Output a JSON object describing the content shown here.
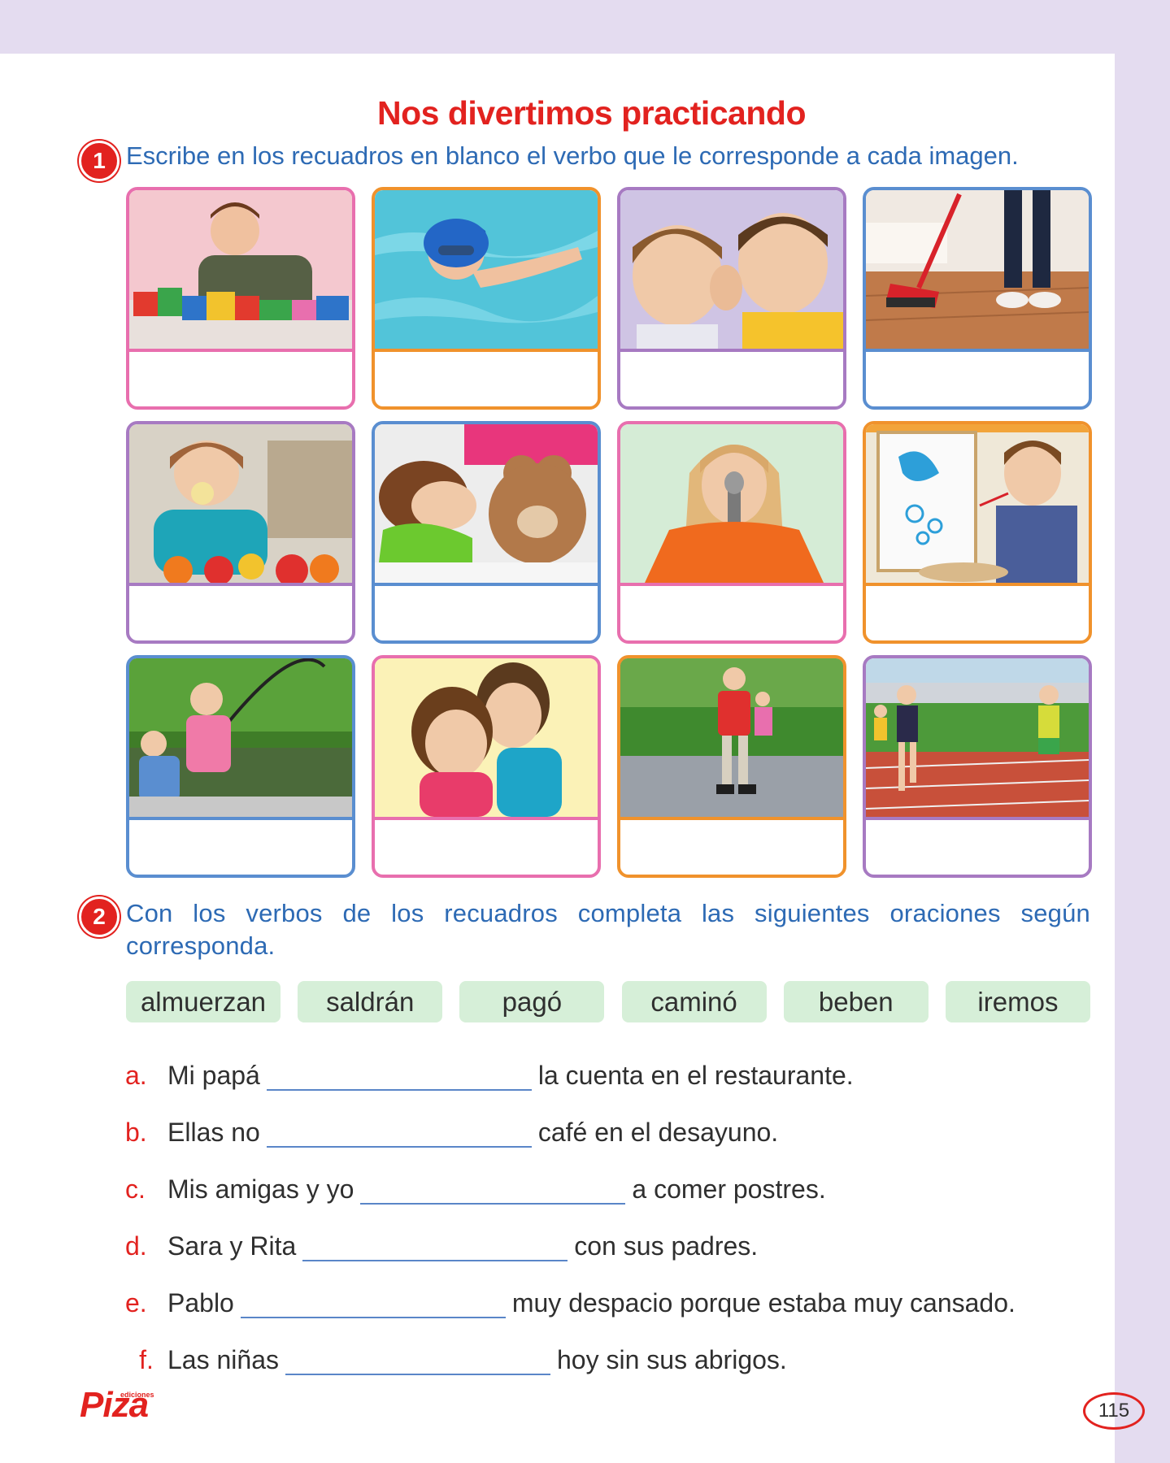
{
  "title": "Nos divertimos practicando",
  "exercise1": {
    "number": "1",
    "instruction": "Escribe en los recuadros en blanco el verbo que le corresponde a cada imagen.",
    "images": [
      {
        "icon": "boy-building-blocks-photo",
        "frame": "#e86fae"
      },
      {
        "icon": "child-swimming-photo",
        "frame": "#f0922c"
      },
      {
        "icon": "boys-whispering-photo",
        "frame": "#a77ac2"
      },
      {
        "icon": "sweeping-floor-photo",
        "frame": "#5a8ed0"
      },
      {
        "icon": "girl-eating-apple-photo",
        "frame": "#a77ac2"
      },
      {
        "icon": "girl-sleeping-teddy-photo",
        "frame": "#5a8ed0"
      },
      {
        "icon": "girl-singing-microphone-photo",
        "frame": "#e86fae"
      },
      {
        "icon": "boy-painting-easel-photo",
        "frame": "#f0922c"
      },
      {
        "icon": "grandfather-fishing-photo",
        "frame": "#5a8ed0"
      },
      {
        "icon": "girls-hugging-photo",
        "frame": "#e86fae"
      },
      {
        "icon": "boy-rollerskating-photo",
        "frame": "#f0922c"
      },
      {
        "icon": "kids-running-track-photo",
        "frame": "#a77ac2"
      }
    ]
  },
  "exercise2": {
    "number": "2",
    "instruction": "Con los verbos de los recuadros completa las siguientes oraciones según corresponda.",
    "verbs": [
      "almuerzan",
      "saldrán",
      "pagó",
      "caminó",
      "beben",
      "iremos"
    ],
    "sentences": [
      {
        "letter": "a.",
        "before": "Mi papá",
        "after": "la cuenta en el restaurante."
      },
      {
        "letter": "b.",
        "before": "Ellas no",
        "after": "café en el desayuno."
      },
      {
        "letter": "c.",
        "before": "Mis amigas y yo",
        "after": "a comer postres."
      },
      {
        "letter": "d.",
        "before": "Sara y Rita",
        "after": "con sus padres."
      },
      {
        "letter": "e.",
        "before": "Pablo",
        "after": "muy despacio porque estaba muy cansado."
      },
      {
        "letter": "f.",
        "before": "Las niñas",
        "after": "hoy sin sus abrigos."
      }
    ]
  },
  "footer": {
    "logo": "Piza",
    "logo_small": "ediciones",
    "page_number": "115"
  }
}
